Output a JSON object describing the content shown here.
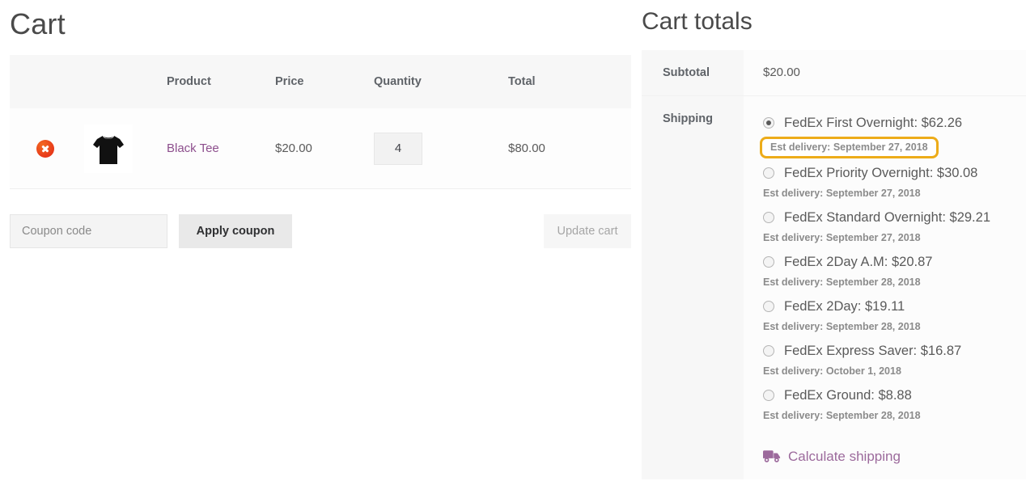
{
  "cart": {
    "title": "Cart",
    "columns": [
      "",
      "",
      "Product",
      "Price",
      "Quantity",
      "Total"
    ],
    "headers": {
      "product": "Product",
      "price": "Price",
      "quantity": "Quantity",
      "total": "Total"
    },
    "rows": [
      {
        "remove_icon": "remove-circle-icon",
        "thumbnail_icon": "black-tshirt-thumbnail",
        "product": "Black Tee",
        "price": "$20.00",
        "quantity": "4",
        "total": "$80.00"
      }
    ],
    "coupon": {
      "placeholder": "Coupon code",
      "value": "",
      "apply_label": "Apply coupon"
    },
    "update_cart_label": "Update cart"
  },
  "totals": {
    "title": "Cart totals",
    "subtotal_label": "Subtotal",
    "subtotal_value": "$20.00",
    "shipping_label": "Shipping",
    "shipping_options": [
      {
        "label": "FedEx First Overnight: $62.26",
        "est": "Est delivery: September 27, 2018",
        "selected": true,
        "highlighted": true
      },
      {
        "label": "FedEx Priority Overnight: $30.08",
        "est": "Est delivery: September 27, 2018",
        "selected": false,
        "highlighted": false
      },
      {
        "label": "FedEx Standard Overnight: $29.21",
        "est": "Est delivery: September 27, 2018",
        "selected": false,
        "highlighted": false
      },
      {
        "label": "FedEx 2Day A.M: $20.87",
        "est": "Est delivery: September 28, 2018",
        "selected": false,
        "highlighted": false
      },
      {
        "label": "FedEx 2Day: $19.11",
        "est": "Est delivery: September 28, 2018",
        "selected": false,
        "highlighted": false
      },
      {
        "label": "FedEx Express Saver: $16.87",
        "est": "Est delivery: October 1, 2018",
        "selected": false,
        "highlighted": false
      },
      {
        "label": "FedEx Ground: $8.88",
        "est": "Est delivery: September 28, 2018",
        "selected": false,
        "highlighted": false
      }
    ],
    "calculate_shipping_label": "Calculate shipping",
    "calculate_shipping_icon": "truck-icon"
  },
  "colors": {
    "link_purple": "#8d4f8d",
    "calc_purple": "#9c6a9c",
    "remove_red": "#e8391a",
    "highlight_gold": "#edac19",
    "header_gray": "#f7f7f7",
    "text_gray": "#5a5a5a"
  }
}
